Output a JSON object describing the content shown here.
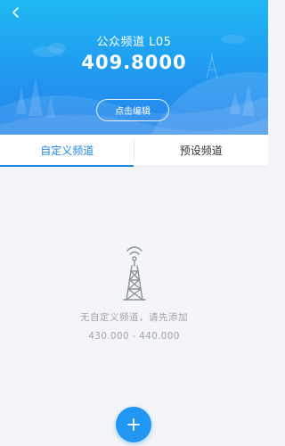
{
  "header": {
    "title": "公众频道 L05",
    "frequency": "409.8000",
    "edit_label": "点击编辑"
  },
  "tabs": [
    {
      "label": "自定义频道",
      "active": true
    },
    {
      "label": "预设频道",
      "active": false
    }
  ],
  "empty_state": {
    "message": "无自定义频道，请先添加",
    "range": "430.000 - 440.000"
  },
  "colors": {
    "accent": "#1e88e5",
    "header_top": "#1fb8f2",
    "header_bottom": "#2585ea",
    "muted_text": "#a1a4aa"
  },
  "icons": {
    "back": "chevron-left-icon",
    "empty": "radio-tower-icon",
    "add": "plus-icon"
  }
}
